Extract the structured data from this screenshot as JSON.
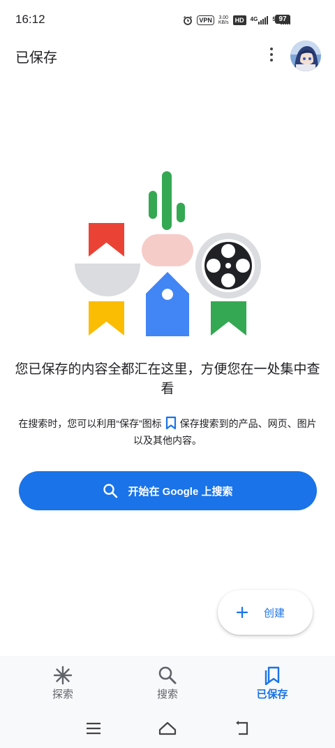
{
  "status_bar": {
    "time": "16:12",
    "vpn": "VPN",
    "speed_value": "3.00",
    "speed_unit": "KB/s",
    "hd_label": "HD",
    "sim1_network": "4G",
    "sim2_network": "5G",
    "battery": "97"
  },
  "header": {
    "title": "已保存",
    "more_icon": "more-vert-icon",
    "avatar_icon": "anime-avatar"
  },
  "empty_state": {
    "title": "您已保存的内容全都汇在这里，方便您在一处集中查看",
    "desc_before_icon": "在搜索时，您可以利用“保存”图标",
    "desc_after_icon": "保存搜索到的产品、网页、图片以及其他内容。"
  },
  "start_button": {
    "label": "开始在 Google 上搜索",
    "icon": "search-icon"
  },
  "fab": {
    "label": "创建",
    "icon": "plus-icon"
  },
  "bottom_nav": {
    "items": [
      {
        "label": "探索",
        "icon": "asterisk-icon",
        "active": false
      },
      {
        "label": "搜索",
        "icon": "search-icon",
        "active": false
      },
      {
        "label": "已保存",
        "icon": "saved-bookmarks-icon",
        "active": true
      }
    ]
  },
  "colors": {
    "accent": "#1a73e8",
    "red": "#ea4335",
    "yellow": "#fbbc04",
    "green": "#34a853",
    "blue": "#4285f4"
  }
}
